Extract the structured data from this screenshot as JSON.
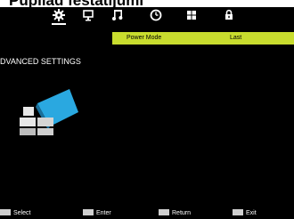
{
  "header": {
    "title": "Pupllad festatijumi"
  },
  "menu": {
    "icons": [
      {
        "name": "settings-gear-icon",
        "active": true
      },
      {
        "name": "monitor-icon",
        "active": false
      },
      {
        "name": "music-note-icon",
        "active": false
      },
      {
        "name": "clock-icon",
        "active": false
      },
      {
        "name": "grid-icon",
        "active": false
      },
      {
        "name": "lock-icon",
        "active": false
      }
    ]
  },
  "options": [
    {
      "label": "Power Mode",
      "value": "Last"
    }
  ],
  "section": {
    "title": "DVANCED SETTINGS"
  },
  "footer": {
    "select_label": "Select",
    "enter_label": "Enter",
    "return_label": "Return",
    "exit_label": "Exit"
  },
  "colors": {
    "highlight": "#c8dc2e",
    "background": "#000000",
    "graphic_blue": "#2aa8e0"
  }
}
